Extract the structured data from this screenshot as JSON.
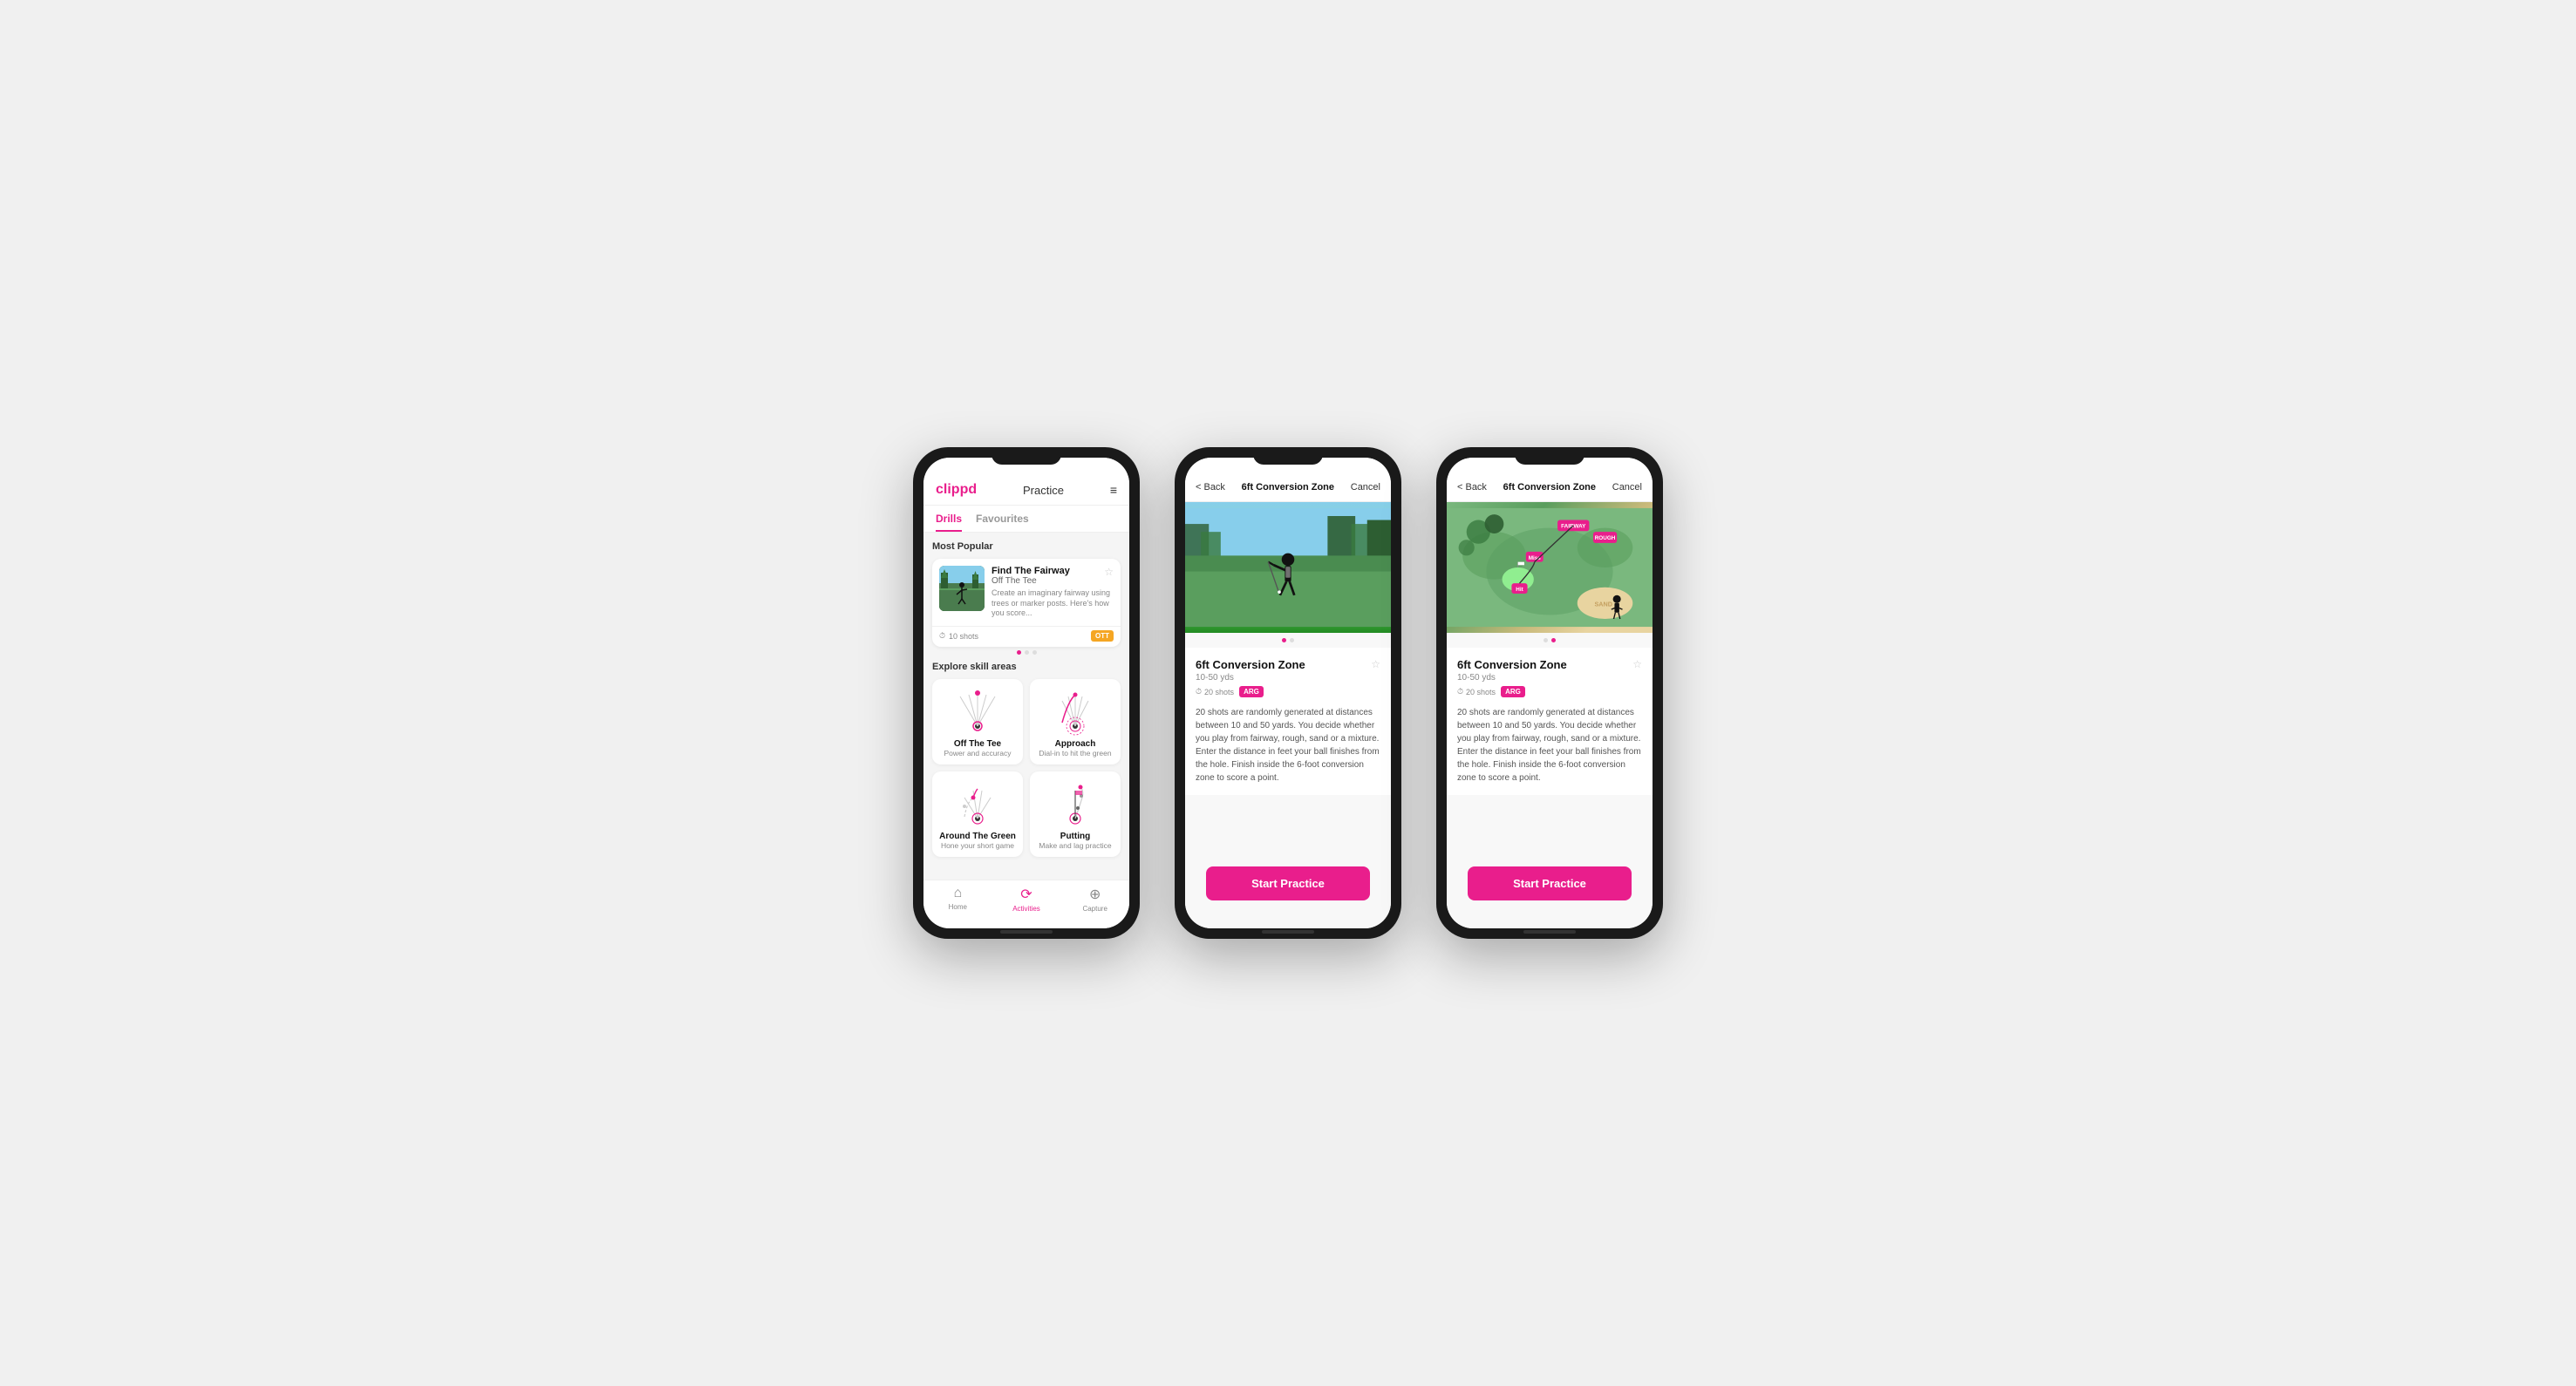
{
  "phone1": {
    "header": {
      "logo": "clippd",
      "title": "Practice",
      "menu_icon": "≡"
    },
    "tabs": [
      {
        "label": "Drills",
        "active": true
      },
      {
        "label": "Favourites",
        "active": false
      }
    ],
    "most_popular_label": "Most Popular",
    "featured_drill": {
      "title": "Find The Fairway",
      "subtitle": "Off The Tee",
      "description": "Create an imaginary fairway using trees or marker posts. Here's how you score...",
      "shots": "10 shots",
      "badge": "OTT"
    },
    "explore_label": "Explore skill areas",
    "skills": [
      {
        "name": "Off The Tee",
        "desc": "Power and accuracy",
        "key": "ott"
      },
      {
        "name": "Approach",
        "desc": "Dial-in to hit the green",
        "key": "approach"
      },
      {
        "name": "Around The Green",
        "desc": "Hone your short game",
        "key": "atg"
      },
      {
        "name": "Putting",
        "desc": "Make and lag practice",
        "key": "putting"
      }
    ],
    "nav": [
      {
        "label": "Home",
        "icon": "⌂",
        "active": false
      },
      {
        "label": "Activities",
        "icon": "⟳",
        "active": true
      },
      {
        "label": "Capture",
        "icon": "⊕",
        "active": false
      }
    ]
  },
  "phone2": {
    "header": {
      "back": "< Back",
      "title": "6ft Conversion Zone",
      "cancel": "Cancel"
    },
    "image_dots": [
      "active",
      "inactive"
    ],
    "drill": {
      "title": "6ft Conversion Zone",
      "range": "10-50 yds",
      "shots": "20 shots",
      "badge": "ARG",
      "description": "20 shots are randomly generated at distances between 10 and 50 yards. You decide whether you play from fairway, rough, sand or a mixture. Enter the distance in feet your ball finishes from the hole. Finish inside the 6-foot conversion zone to score a point.",
      "start_button": "Start Practice"
    }
  },
  "phone3": {
    "header": {
      "back": "< Back",
      "title": "6ft Conversion Zone",
      "cancel": "Cancel"
    },
    "image_dots": [
      "inactive",
      "active"
    ],
    "drill": {
      "title": "6ft Conversion Zone",
      "range": "10-50 yds",
      "shots": "20 shots",
      "badge": "ARG",
      "description": "20 shots are randomly generated at distances between 10 and 50 yards. You decide whether you play from fairway, rough, sand or a mixture. Enter the distance in feet your ball finishes from the hole. Finish inside the 6-foot conversion zone to score a point.",
      "start_button": "Start Practice"
    }
  }
}
